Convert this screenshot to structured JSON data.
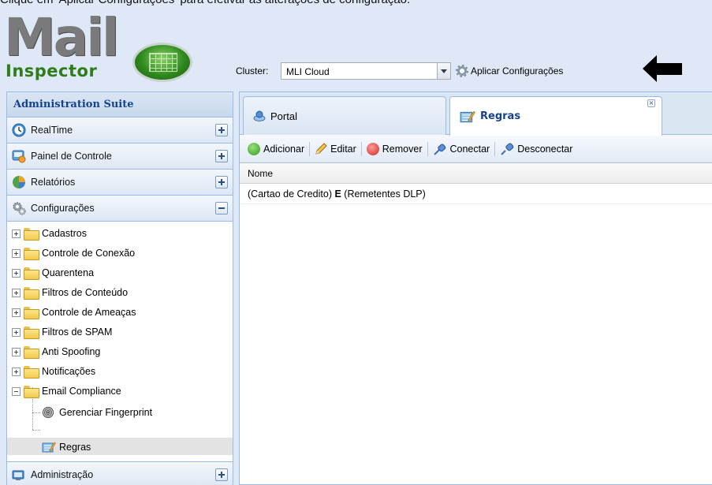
{
  "caption": "Clique em 'Aplicar Configurações' para efetivar as alterações de configuração.",
  "logo": {
    "word": "Mail",
    "sub": "Inspector"
  },
  "cluster": {
    "label": "Cluster:",
    "value": "MLI Cloud"
  },
  "apply_label": "Aplicar Configurações",
  "sidebar": {
    "title": "Administration Suite",
    "sections": [
      {
        "label": "RealTime",
        "icon": "realtime-clock-icon",
        "state": "collapsed"
      },
      {
        "label": "Painel de Controle",
        "icon": "control-panel-icon",
        "state": "collapsed"
      },
      {
        "label": "Relatórios",
        "icon": "reports-pie-icon",
        "state": "collapsed"
      },
      {
        "label": "Configurações",
        "icon": "settings-gear-icon",
        "state": "expanded"
      },
      {
        "label": "Administração",
        "icon": "administration-icon",
        "state": "collapsed"
      }
    ],
    "tree": [
      {
        "label": "Cadastros",
        "expanded": false
      },
      {
        "label": "Controle de Conexão",
        "expanded": false
      },
      {
        "label": "Quarentena",
        "expanded": false
      },
      {
        "label": "Filtros de Conteúdo",
        "expanded": false
      },
      {
        "label": "Controle de Ameaças",
        "expanded": false
      },
      {
        "label": "Filtros de SPAM",
        "expanded": false
      },
      {
        "label": "Anti Spoofing",
        "expanded": false
      },
      {
        "label": "Notificações",
        "expanded": false
      },
      {
        "label": "Email Compliance",
        "expanded": true
      },
      {
        "label": "Gerenciar Fingerprint",
        "icon": "fingerprint-icon"
      },
      {
        "label": "Regras",
        "icon": "rules-icon",
        "selected": true
      }
    ]
  },
  "tabs": [
    {
      "label": "Portal",
      "icon": "portal-icon",
      "active": false
    },
    {
      "label": "Regras",
      "icon": "rules-icon",
      "active": true
    }
  ],
  "toolbar": {
    "add": "Adicionar",
    "edit": "Editar",
    "remove": "Remover",
    "connect": "Conectar",
    "disconnect": "Desconectar"
  },
  "grid": {
    "columns": [
      "Nome"
    ],
    "rows": [
      {
        "pre": "(Cartao de Credito) ",
        "op": "E",
        "post": " (Remetentes DLP)"
      }
    ]
  },
  "colors": {
    "accent": "#15428b",
    "border": "#99bbe8",
    "background": "#dfe8f6"
  }
}
